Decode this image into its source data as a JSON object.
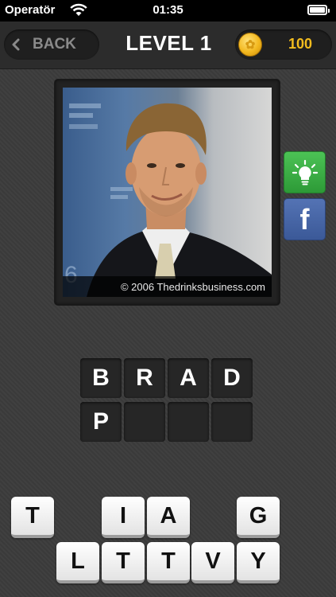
{
  "status_bar": {
    "carrier": "Operatör",
    "time": "01:35"
  },
  "header": {
    "back_label": "BACK",
    "title": "LEVEL 1",
    "coins": "100"
  },
  "photo": {
    "credit": "© 2006 Thedrinksbusiness.com"
  },
  "answer": {
    "slots": [
      "B",
      "R",
      "A",
      "D",
      "P",
      "",
      "",
      ""
    ]
  },
  "letters": {
    "row1": [
      "T",
      "",
      "I",
      "A",
      "",
      "G"
    ],
    "row2": [
      "L",
      "T",
      "T",
      "V",
      "Y"
    ]
  },
  "colors": {
    "accent_gold": "#f2bc1e",
    "hint_green": "#3aae45",
    "facebook_blue": "#3b5998"
  }
}
